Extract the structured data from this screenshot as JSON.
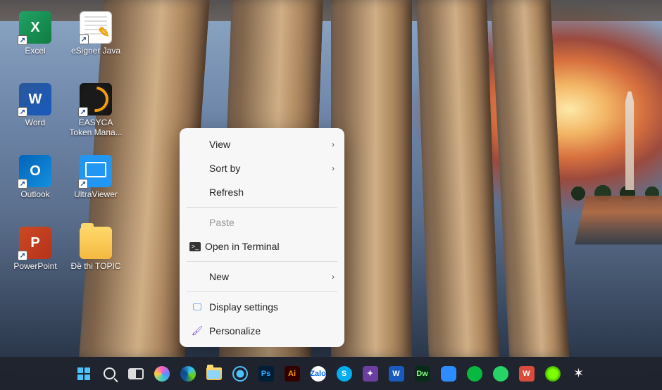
{
  "desktop_icons": [
    {
      "id": "excel",
      "label": "Excel",
      "letter": "X",
      "cls": "excel"
    },
    {
      "id": "esigner",
      "label": "eSigner Java",
      "letter": "",
      "cls": "esigner"
    },
    {
      "id": "word",
      "label": "Word",
      "letter": "W",
      "cls": "word"
    },
    {
      "id": "easyca",
      "label": "EASYCA Token Mana...",
      "letter": "",
      "cls": "easyca"
    },
    {
      "id": "outlook",
      "label": "Outlook",
      "letter": "O",
      "cls": "outlook"
    },
    {
      "id": "ultraviewer",
      "label": "UltraViewer",
      "letter": "",
      "cls": "ultrav"
    },
    {
      "id": "powerpoint",
      "label": "PowerPoint",
      "letter": "P",
      "cls": "ppt"
    },
    {
      "id": "dethitopic",
      "label": "Đề thi TOPIC",
      "letter": "",
      "cls": "folder"
    }
  ],
  "context_menu": {
    "view": "View",
    "sort_by": "Sort by",
    "refresh": "Refresh",
    "paste": "Paste",
    "open_terminal": "Open in Terminal",
    "new": "New",
    "display_settings": "Display settings",
    "personalize": "Personalize"
  },
  "taskbar": {
    "items": [
      {
        "id": "start",
        "name": "start-button"
      },
      {
        "id": "search",
        "name": "search-button"
      },
      {
        "id": "taskview",
        "name": "task-view-button"
      },
      {
        "id": "copilot",
        "name": "copilot-button"
      },
      {
        "id": "edge",
        "name": "edge-app"
      },
      {
        "id": "explorer",
        "name": "file-explorer-app"
      },
      {
        "id": "cortana",
        "name": "assistant-app"
      },
      {
        "id": "ps",
        "name": "photoshop-app",
        "text": "Ps"
      },
      {
        "id": "ai",
        "name": "illustrator-app",
        "text": "Ai"
      },
      {
        "id": "zalo",
        "name": "zalo-app",
        "text": "Zalo"
      },
      {
        "id": "skype",
        "name": "skype-app",
        "text": "S"
      },
      {
        "id": "foxit",
        "name": "foxit-app",
        "text": "✦"
      },
      {
        "id": "wordtb",
        "name": "word-app",
        "text": "W"
      },
      {
        "id": "dw",
        "name": "dreamweaver-app",
        "text": "Dw"
      },
      {
        "id": "zoom",
        "name": "zoom-app",
        "text": ""
      },
      {
        "id": "wechat",
        "name": "wechat-app",
        "text": ""
      },
      {
        "id": "whatsapp",
        "name": "whatsapp-app",
        "text": ""
      },
      {
        "id": "wps",
        "name": "wps-app",
        "text": "W"
      },
      {
        "id": "neon",
        "name": "green-app",
        "text": ""
      },
      {
        "id": "eagle",
        "name": "eagle-app",
        "text": "✦"
      }
    ]
  }
}
